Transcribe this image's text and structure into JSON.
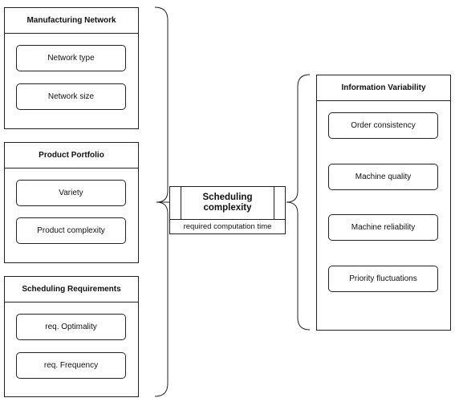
{
  "left_groups": [
    {
      "title": "Manufacturing Network",
      "items": [
        "Network type",
        "Network size"
      ]
    },
    {
      "title": "Product Portfolio",
      "items": [
        "Variety",
        "Product complexity"
      ]
    },
    {
      "title": "Scheduling Requirements",
      "items": [
        "req. Optimality",
        "req. Frequency"
      ]
    }
  ],
  "center": {
    "title": "Scheduling complexity",
    "subtitle": "required computation time"
  },
  "right_group": {
    "title": "Information Variability",
    "items": [
      "Order consistency",
      "Machine quality",
      "Machine reliability",
      "Priority fluctuations"
    ]
  }
}
